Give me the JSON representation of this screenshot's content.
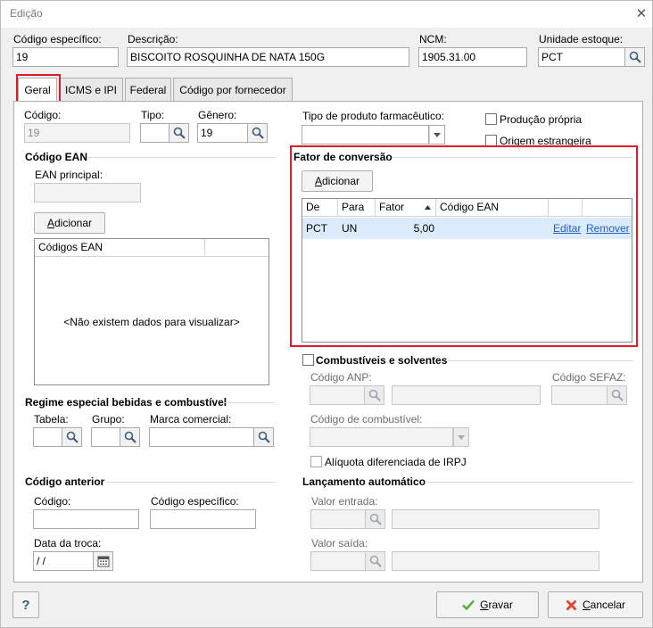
{
  "window": {
    "title": "Edição"
  },
  "header": {
    "codigo_especifico": {
      "label": "Código específico:",
      "value": "19"
    },
    "descricao": {
      "label": "Descrição:",
      "value": "BISCOITO ROSQUINHA DE NATA 150G"
    },
    "ncm": {
      "label": "NCM:",
      "value": "1905.31.00"
    },
    "unidade": {
      "label": "Unidade estoque:",
      "value": "PCT"
    }
  },
  "tabs": [
    {
      "label": "Geral"
    },
    {
      "label": "ICMS e IPI"
    },
    {
      "label": "Federal"
    },
    {
      "label": "Código por fornecedor"
    }
  ],
  "geral": {
    "codigo": {
      "label": "Código:",
      "value": "19"
    },
    "tipo": {
      "label": "Tipo:",
      "value": ""
    },
    "genero": {
      "label": "Gênero:",
      "value": "19"
    },
    "tipo_farma": {
      "label": "Tipo de produto farmacêutico:",
      "value": ""
    },
    "producao_propria": "Produção própria",
    "origem_estrangeira": "Origem estrangeira",
    "ean": {
      "title": "Código EAN",
      "principal_label": "EAN principal:",
      "principal_value": "",
      "add_prefix": "A",
      "add_rest": "dicionar",
      "column": "Códigos EAN",
      "empty": "<Não existem dados para visualizar>"
    },
    "fator": {
      "title": "Fator de conversão",
      "add_prefix": "A",
      "add_rest": "dicionar",
      "columns": [
        "De",
        "Para",
        "Fator",
        "Código EAN"
      ],
      "rows": [
        {
          "de": "PCT",
          "para": "UN",
          "fator": "5,00",
          "codigo_ean": "",
          "edit": "Editar",
          "remove": "Remover"
        }
      ]
    },
    "combustiveis": {
      "title": "Combustíveis e solventes",
      "codigo_anp": "Código ANP:",
      "codigo_sefaz": "Código SEFAZ:",
      "codigo_combustivel": "Código de combustível:",
      "aliquota": "Alíquota diferenciada de IRPJ"
    },
    "regime": {
      "title": "Regime especial bebidas e combustível",
      "tabela": "Tabela:",
      "grupo": "Grupo:",
      "marca": "Marca comercial:"
    },
    "anterior": {
      "title": "Código anterior",
      "codigo": "Código:",
      "codigo_especifico": "Código específico:",
      "data_troca_label": "Data da troca:",
      "data_troca_value": " / /"
    },
    "lancamento": {
      "title": "Lançamento automático",
      "valor_entrada": "Valor entrada:",
      "valor_saida": "Valor saída:"
    }
  },
  "footer": {
    "help": "?",
    "save_prefix": "G",
    "save_rest": "ravar",
    "cancel_prefix": "C",
    "cancel_rest": "ancelar"
  }
}
